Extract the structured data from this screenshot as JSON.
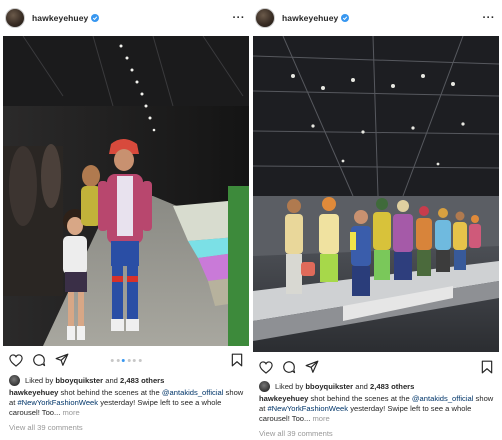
{
  "posts": [
    {
      "username": "hawkeyehuey",
      "liked_by_prefix": "Liked by",
      "liked_by_user": "bboyquikster",
      "liked_by_joiner": "and",
      "liked_by_count": "2,483 others",
      "caption": {
        "author": "hawkeyehuey",
        "part1": " shot behind the scenes at the ",
        "mention": "@antakids_official",
        "part2": " show at ",
        "hashtag": "#NewYorkFashionWeek",
        "part3": " yesterday!  Swipe left to see a whole carousel! Too... ",
        "more": "more"
      },
      "comments_link": "View all 39 comments",
      "carousel_active_index": 2,
      "carousel_count": 6
    },
    {
      "username": "hawkeyehuey",
      "liked_by_prefix": "Liked by",
      "liked_by_user": "bboyquikster",
      "liked_by_joiner": "and",
      "liked_by_count": "2,483 others",
      "caption": {
        "author": "hawkeyehuey",
        "part1": " shot behind the scenes at the ",
        "mention": "@antakids_official",
        "part2": " show at ",
        "hashtag": "#NewYorkFashionWeek",
        "part3": " yesterday!  Swipe left to see a whole carousel! Too... ",
        "more": "more"
      },
      "comments_link": "View all 39 comments"
    }
  ],
  "icons": {
    "more": "more-options-icon",
    "verified": "verified-badge-icon",
    "like": "heart-icon",
    "comment": "comment-icon",
    "share": "send-icon",
    "save": "bookmark-icon"
  },
  "colors": {
    "verified": "#3897f0",
    "link": "#003569",
    "muted": "#999999",
    "text": "#262626"
  }
}
